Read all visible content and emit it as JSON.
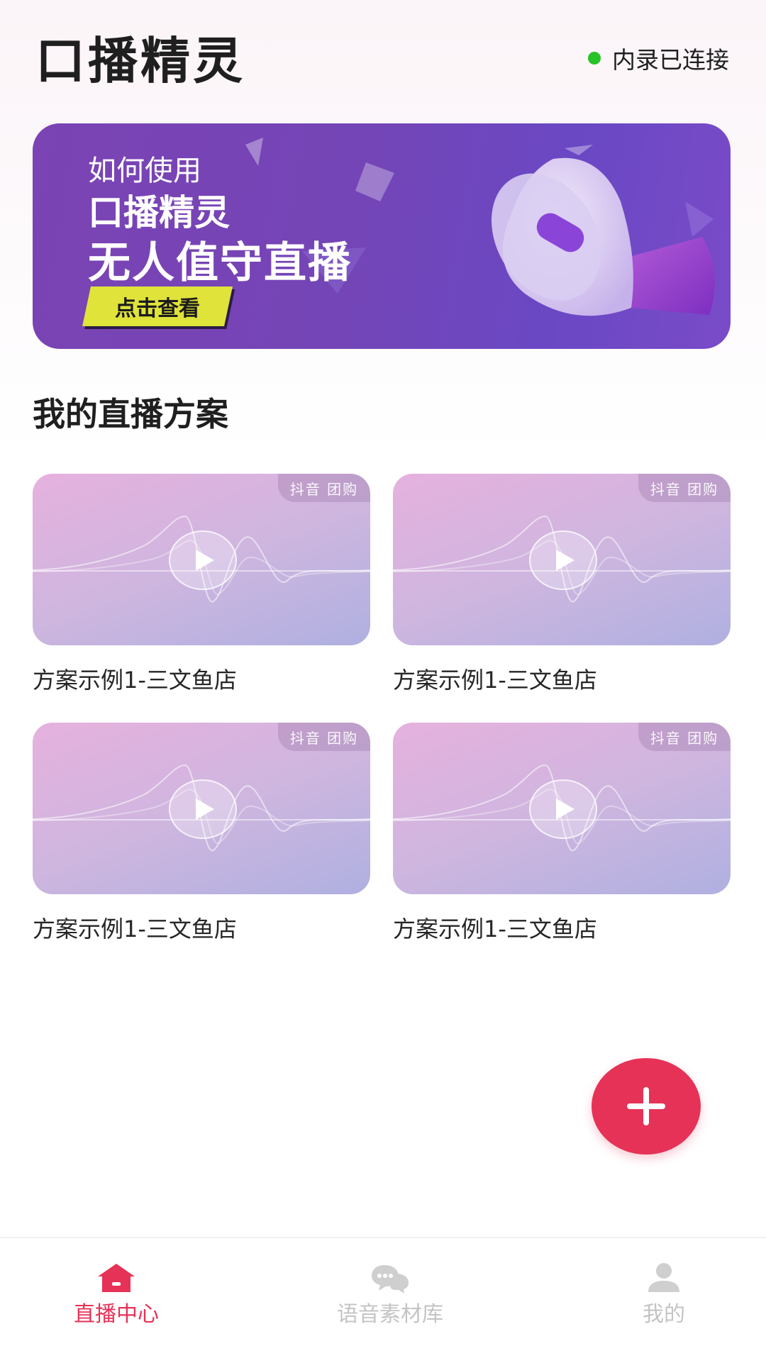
{
  "header": {
    "title": "口播精灵",
    "status_text": "内录已连接",
    "status_color": "#27c327"
  },
  "banner": {
    "line1": "如何使用",
    "line2": "口播精灵",
    "line3": "无人值守直播",
    "button_label": "点击查看"
  },
  "section": {
    "title": "我的直播方案"
  },
  "cards": [
    {
      "badge": "抖音 团购",
      "title": "方案示例1-三文鱼店"
    },
    {
      "badge": "抖音 团购",
      "title": "方案示例1-三文鱼店"
    },
    {
      "badge": "抖音 团购",
      "title": "方案示例1-三文鱼店"
    },
    {
      "badge": "抖音 团购",
      "title": "方案示例1-三文鱼店"
    }
  ],
  "fab": {
    "icon": "plus-icon",
    "color": "#e63257"
  },
  "bottom_nav": {
    "items": [
      {
        "label": "直播中心",
        "icon": "home-icon",
        "active": true
      },
      {
        "label": "语音素材库",
        "icon": "chat-icon",
        "active": false
      },
      {
        "label": "我的",
        "icon": "user-icon",
        "active": false
      }
    ],
    "active_color": "#e63257",
    "inactive_color": "#c4c4c4"
  }
}
